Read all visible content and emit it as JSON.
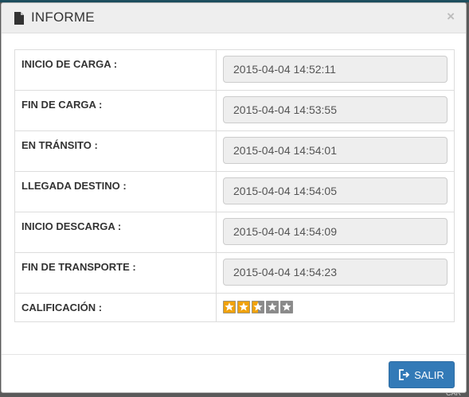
{
  "dialog": {
    "title": "INFORME",
    "close_label": "×"
  },
  "rows": [
    {
      "label": "INICIO DE CARGA :",
      "value": "2015-04-04 14:52:11"
    },
    {
      "label": "FIN DE CARGA :",
      "value": "2015-04-04 14:53:55"
    },
    {
      "label": "EN TRÁNSITO :",
      "value": "2015-04-04 14:54:01"
    },
    {
      "label": "LLEGADA DESTINO :",
      "value": "2015-04-04 14:54:05"
    },
    {
      "label": "INICIO DESCARGA :",
      "value": "2015-04-04 14:54:09"
    },
    {
      "label": "FIN DE TRANSPORTE :",
      "value": "2015-04-04 14:54:23"
    }
  ],
  "rating": {
    "label": "CALIFICACIÓN :",
    "value": 2.5,
    "max": 5
  },
  "footer": {
    "exit_label": "SALIR"
  },
  "background": {
    "fragment": "CAR"
  },
  "icons": {
    "title": "document-icon",
    "exit": "sign-out-icon",
    "close": "close-icon"
  },
  "colors": {
    "primary_button": "#337ab7",
    "star_filled": "#f0a20c",
    "star_empty": "#8a8a8a"
  }
}
